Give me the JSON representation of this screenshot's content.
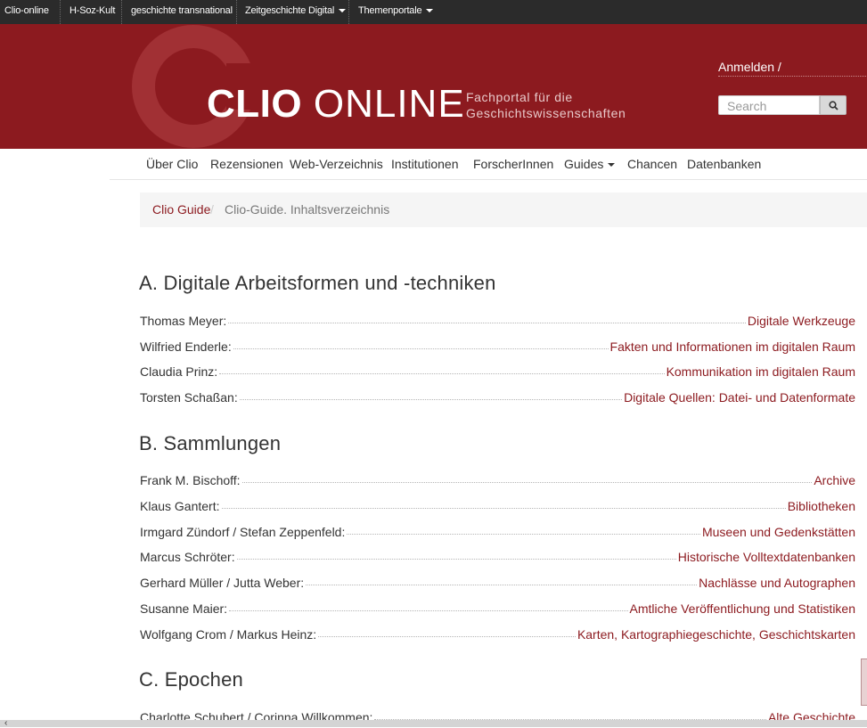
{
  "topbar": {
    "items": [
      {
        "label": "Clio-online"
      },
      {
        "label": "H-Soz-Kult"
      },
      {
        "label": "geschichte transnational"
      },
      {
        "label": "Zeitgeschichte Digital"
      },
      {
        "label": "Themenportale"
      }
    ]
  },
  "header": {
    "logo_clio": "CLIO",
    "logo_online": "ONLINE",
    "tagline_line1": "Fachportal für die",
    "tagline_line2": "Geschichtswissenschaften",
    "login": "Anmelden /",
    "search_placeholder": "Search",
    "search_icon": "search-icon"
  },
  "nav": {
    "items": [
      {
        "label": "Über Clio"
      },
      {
        "label": "Rezensionen"
      },
      {
        "label": "Web-Verzeichnis"
      },
      {
        "label": "Institutionen"
      },
      {
        "label": "ForscherInnen"
      },
      {
        "label": "Guides"
      },
      {
        "label": "Chancen"
      },
      {
        "label": "Datenbanken"
      }
    ]
  },
  "breadcrumb": {
    "link": "Clio Guide",
    "separator": "/",
    "current": "Clio-Guide. Inhaltsverzeichnis"
  },
  "sections": [
    {
      "heading": "A. Digitale Arbeitsformen und -techniken",
      "entries": [
        {
          "author": "Thomas Meyer:",
          "title": "Digitale Werkzeuge"
        },
        {
          "author": "Wilfried Enderle:",
          "title": "Fakten und Informationen im digitalen Raum"
        },
        {
          "author": "Claudia Prinz:",
          "title": "Kommunikation im digitalen Raum"
        },
        {
          "author": "Torsten Schaßan:",
          "title": "Digitale Quellen: Datei- und Datenformate"
        }
      ]
    },
    {
      "heading": "B. Sammlungen",
      "entries": [
        {
          "author": "Frank M. Bischoff:",
          "title": "Archive"
        },
        {
          "author": "Klaus Gantert:",
          "title": "Bibliotheken"
        },
        {
          "author": "Irmgard Zündorf / Stefan Zeppenfeld:",
          "title": "Museen und Gedenkstätten"
        },
        {
          "author": "Marcus Schröter:",
          "title": "Historische Volltextdatenbanken"
        },
        {
          "author": "Gerhard Müller / Jutta Weber:",
          "title": "Nachlässe und Autographen"
        },
        {
          "author": "Susanne Maier:",
          "title": "Amtliche Veröffentlichung und Statistiken"
        },
        {
          "author": "Wolfgang Crom / Markus Heinz:",
          "title": "Karten, Kartographiegeschichte, Geschichtskarten"
        }
      ]
    },
    {
      "heading": "C. Epochen",
      "entries": [
        {
          "author": "Charlotte Schubert / Corinna Willkommen:",
          "title": "Alte Geschichte"
        }
      ]
    }
  ],
  "colors": {
    "brand": "#8c1a1f",
    "topbar": "#2b2b2b",
    "link": "#8c1a1f"
  }
}
